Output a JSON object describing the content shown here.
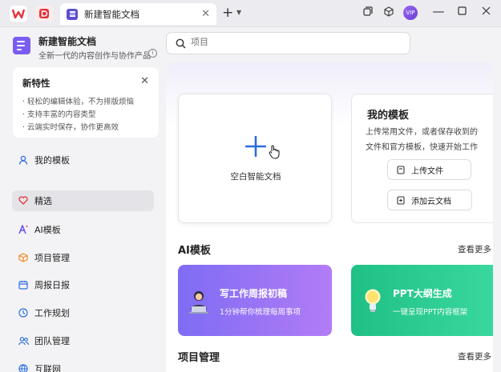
{
  "titlebar": {
    "tab_title": "新建智能文档",
    "tab_close": "✕",
    "new_tab": "+",
    "avatar_text": "VIP",
    "apps": [
      "wps-logo-icon",
      "docs-app-icon"
    ]
  },
  "brand": {
    "title": "新建智能文档",
    "subtitle": "全新一代的内容创作与协作产品",
    "info": "i"
  },
  "news": {
    "title": "新特性",
    "close": "✕",
    "items": [
      "· 轻松的编辑体验，不为排版烦恼",
      "· 支持丰富的内容类型",
      "· 云端实时保存，协作更高效"
    ]
  },
  "nav": {
    "my_templates": "我的模板",
    "items": [
      {
        "label": "精选",
        "icon": "heart-icon",
        "active": true
      },
      {
        "label": "AI模板",
        "icon": "ai-icon"
      },
      {
        "label": "项目管理",
        "icon": "box-icon"
      },
      {
        "label": "周报日报",
        "icon": "calendar-icon"
      },
      {
        "label": "工作规划",
        "icon": "clock-icon"
      },
      {
        "label": "团队管理",
        "icon": "team-icon"
      },
      {
        "label": "互联网",
        "icon": "globe-icon"
      }
    ]
  },
  "search": {
    "placeholder": "项目"
  },
  "blank_card": {
    "label": "空白智能文档"
  },
  "template_card": {
    "title": "我的模板",
    "desc_line1": "上传常用文件，或者保存收到的",
    "desc_line2": "文件和官方模板，快速开始工作",
    "upload_btn": "上传文件",
    "add_cloud_btn": "添加云文档"
  },
  "ai_section": {
    "title": "AI模板",
    "more": "查看更多",
    "cards": [
      {
        "title": "写工作周报初稿",
        "subtitle": "1分钟帮你梳理每周事项",
        "color_from": "#7e6cf3",
        "color_to": "#b27cf6"
      },
      {
        "title": "PPT大纲生成",
        "subtitle": "一键呈现PPT内容框架",
        "color_from": "#20c48a",
        "color_to": "#3bd9a0"
      }
    ]
  },
  "project_section": {
    "title": "项目管理",
    "more": "查看更多"
  },
  "colors": {
    "accent": "#2b6de0",
    "brand_purple": "#7b5cf0",
    "wps_red": "#e8323a"
  }
}
